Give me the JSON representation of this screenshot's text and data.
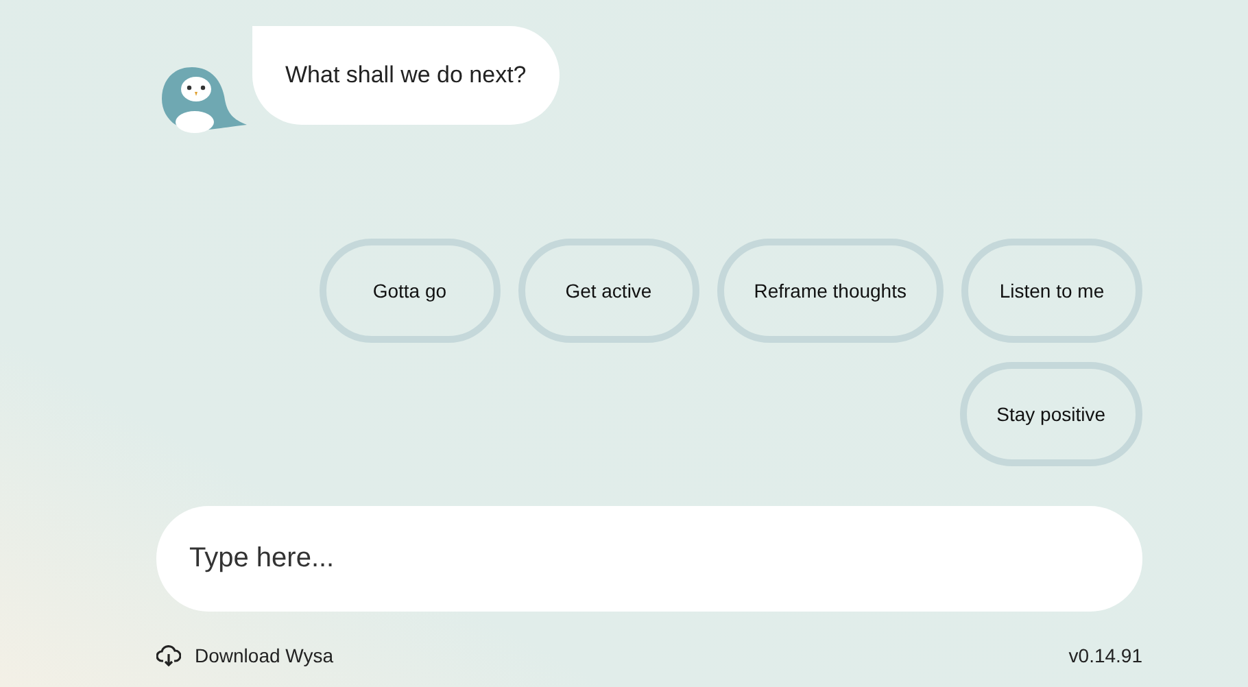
{
  "message": {
    "text": "What shall we do next?"
  },
  "quick_replies": [
    {
      "label": "Gotta go"
    },
    {
      "label": "Get active"
    },
    {
      "label": "Reframe thoughts"
    },
    {
      "label": "Listen to me"
    },
    {
      "label": "Stay positive"
    }
  ],
  "input": {
    "placeholder": "Type here..."
  },
  "footer": {
    "download": "Download Wysa",
    "version": "v0.14.91"
  }
}
